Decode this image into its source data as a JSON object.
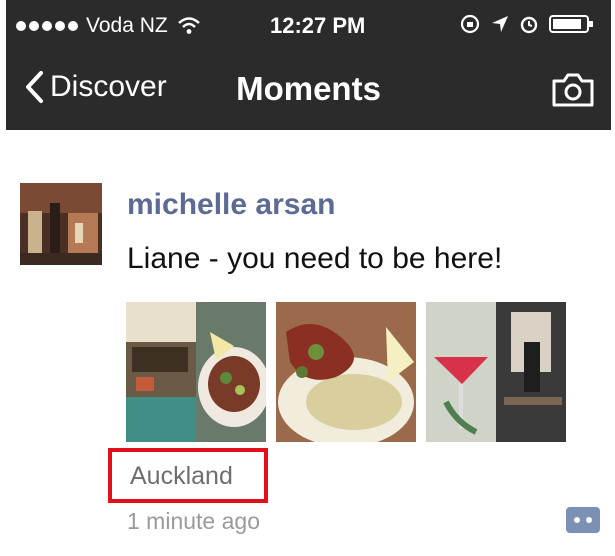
{
  "status_bar": {
    "carrier": "Voda NZ",
    "time": "12:27 PM",
    "signal_dots": 5
  },
  "nav": {
    "back_label": "Discover",
    "title": "Moments"
  },
  "post": {
    "author": "michelle arsan",
    "text": "Liane - you need to be here!",
    "location": "Auckland",
    "timestamp": "1 minute ago",
    "photo_count": 3
  },
  "colors": {
    "bar_bg": "#2b2b2b",
    "author_name": "#5d6a94",
    "highlight_border": "#e3101b",
    "comment_icon": "#7c8fb5"
  },
  "icons": [
    "chevron-left-icon",
    "camera-icon",
    "wifi-icon",
    "location-arrow-icon",
    "alarm-icon",
    "battery-icon",
    "comment-icon"
  ]
}
